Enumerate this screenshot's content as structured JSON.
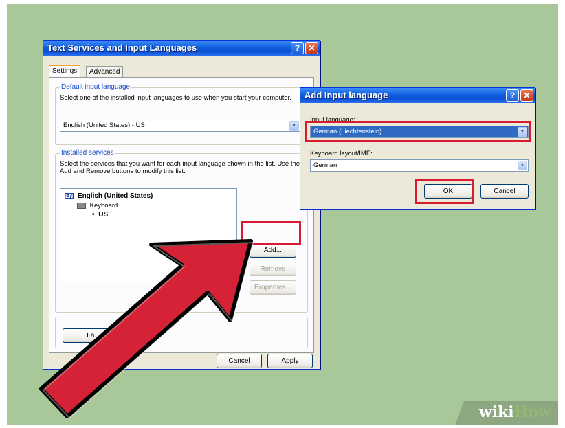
{
  "main_dialog": {
    "title": "Text Services and Input Languages",
    "tabs": [
      {
        "label": "Settings",
        "active": true
      },
      {
        "label": "Advanced",
        "active": false
      }
    ],
    "default_language": {
      "group_label": "Default input language",
      "description": "Select one of the installed input languages to use when you start your computer.",
      "selected": "English (United States) - US"
    },
    "installed_services": {
      "group_label": "Installed services",
      "description": "Select the services that you want for each input language shown in the list. Use the Add and Remove buttons to modify this list.",
      "tree": {
        "language_badge": "EN",
        "language": "English (United States)",
        "service": "Keyboard",
        "layout": "US"
      },
      "buttons": {
        "add": "Add...",
        "remove": "Remove",
        "properties": "Properties..."
      }
    },
    "preferences_button": "La...",
    "footer_buttons": {
      "cancel": "Cancel",
      "apply": "Apply"
    }
  },
  "add_dialog": {
    "title": "Add Input language",
    "input_language_label": "Input language:",
    "input_language_value": "German (Liechtenstein)",
    "keyboard_label": "Keyboard layout/IME:",
    "keyboard_value": "German",
    "ok": "OK",
    "cancel": "Cancel"
  },
  "watermark": {
    "wiki": "wiki",
    "how": "How"
  },
  "colors": {
    "highlight": "#d81b31",
    "arrow": "#d62236",
    "background": "#a9c89a",
    "xp_blue": "#0a4fd1"
  }
}
